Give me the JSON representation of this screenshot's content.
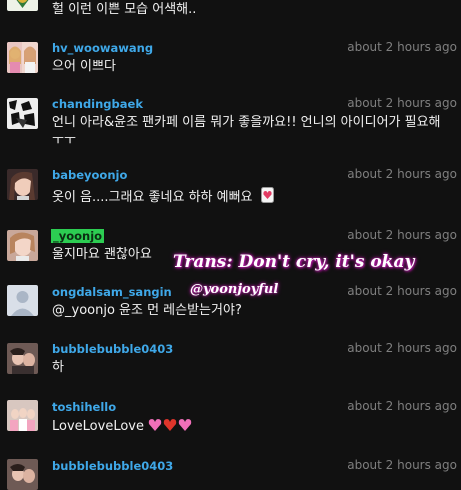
{
  "comments": [
    {
      "username": "",
      "text": "헐 이런 이쁜 모습 어색해..",
      "time": ""
    },
    {
      "username": "hv_woowawang",
      "text": "으어 이쁘다",
      "time": "about 2 hours ago"
    },
    {
      "username": "chandingbaek",
      "text": "언니 아라&윤조 팬카페 이름 뭐가 좋을까요!! 언니의 아이디어가 필요해 ㅜㅜ",
      "time": "about 2 hours ago"
    },
    {
      "username": "babeyoonjo",
      "text": "옷이 음....그래요 좋네요 하하 예뻐요",
      "time": "about 2 hours ago"
    },
    {
      "username": "_yoonjo",
      "text": "울지마요 괜찮아요",
      "time": "about 2 hours ago"
    },
    {
      "username": "ongdalsam_sangin",
      "text": "@_yoonjo 윤조 먼 레슨받는거야?",
      "time": "about 2 hours ago"
    },
    {
      "username": "bubblebubble0403",
      "text": "하",
      "time": "about 2 hours ago"
    },
    {
      "username": "toshihello",
      "text": "LoveLoveLove",
      "time": "about 2 hours ago"
    },
    {
      "username": "bubblebubble0403",
      "text": "",
      "time": "about 2 hours ago"
    }
  ],
  "overlay": {
    "translation": "Trans: Don't cry, it's okay",
    "credit": "@yoonjoyful"
  },
  "icons": {
    "heart_emoji": "heart-emoji",
    "hearts_emoji": "sparkling-hearts-emoji"
  },
  "colors": {
    "background": "#111111",
    "username": "#3fa8e8",
    "highlight": "#2ccd52",
    "timestamp": "#7f7f7f",
    "message": "#f2f2f2",
    "overlay_glow": "#c21fb0"
  }
}
